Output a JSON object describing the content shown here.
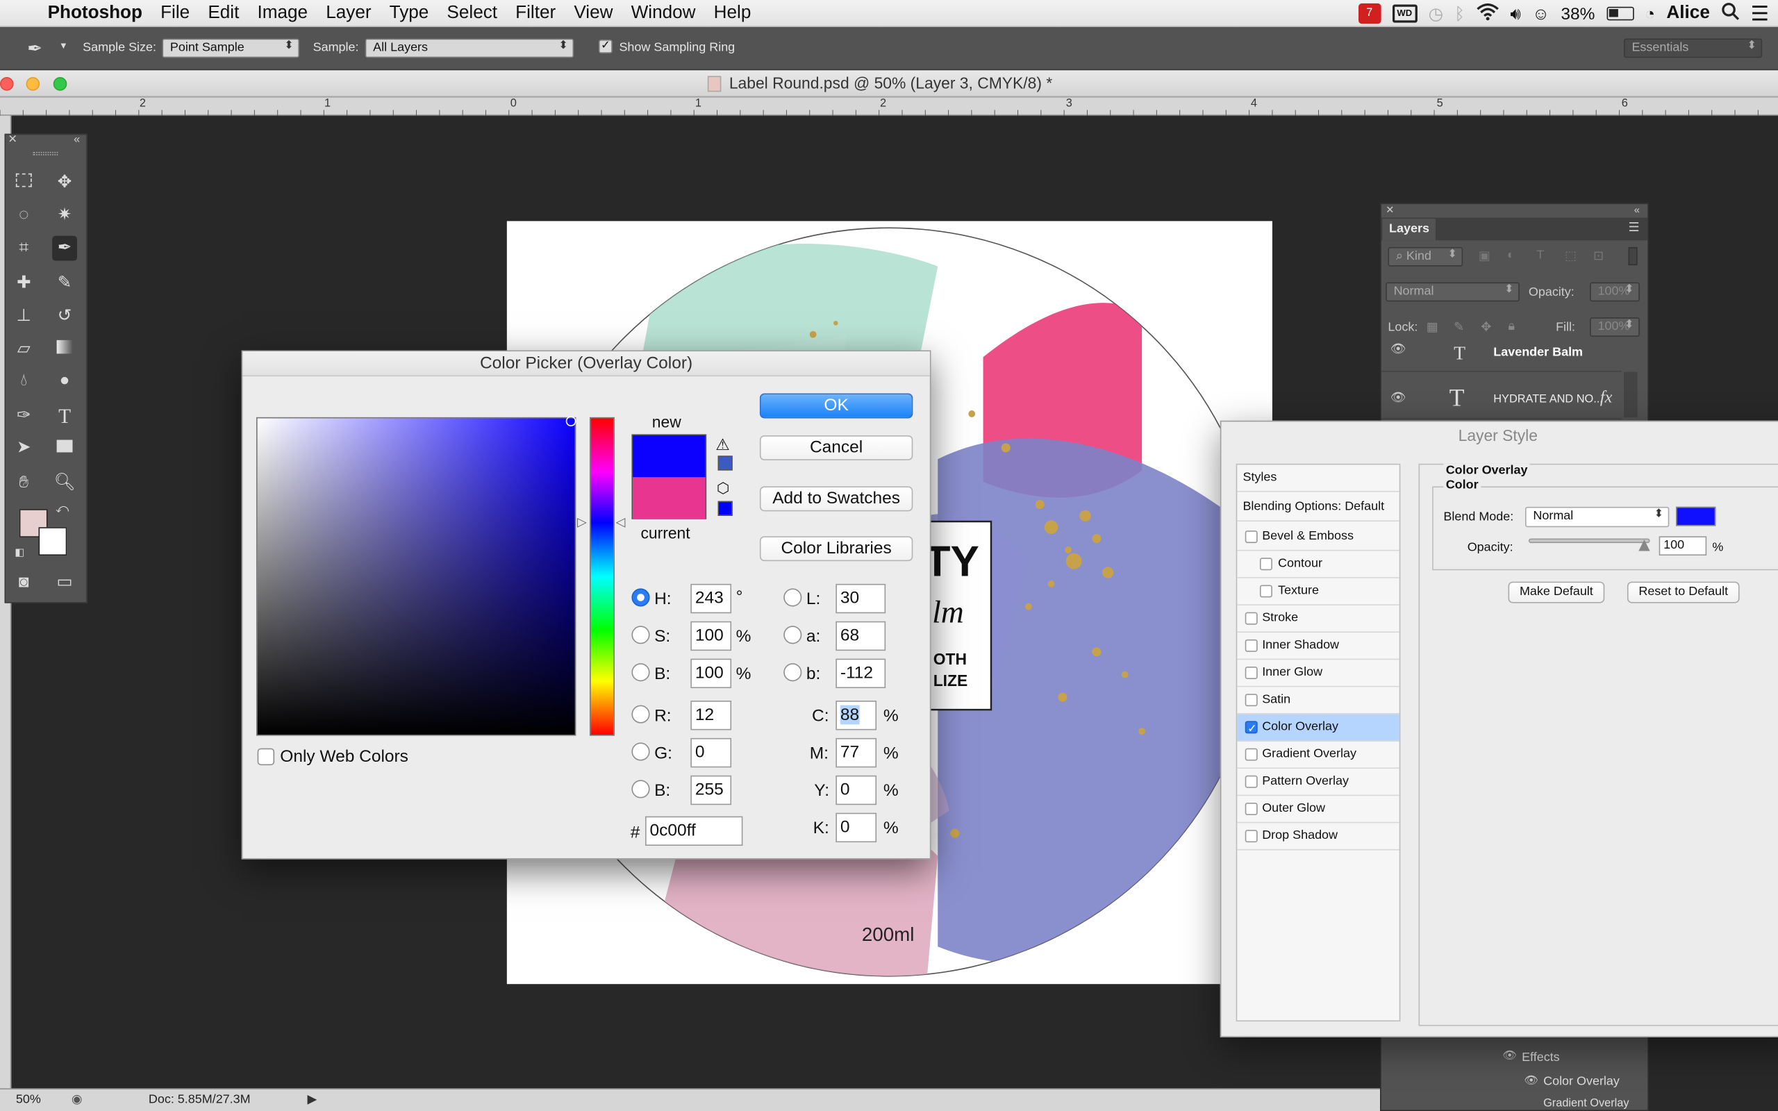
{
  "menubar": {
    "apple": "",
    "app": "Photoshop",
    "items": [
      "File",
      "Edit",
      "Image",
      "Layer",
      "Type",
      "Select",
      "Filter",
      "View",
      "Window",
      "Help"
    ],
    "battery": "38%",
    "user": "Alice"
  },
  "options": {
    "sample_size_label": "Sample Size:",
    "sample_size_value": "Point Sample",
    "sample_label": "Sample:",
    "sample_value": "All Layers",
    "show_ring_label": "Show Sampling Ring",
    "workspace": "Essentials"
  },
  "document": {
    "title": "Label Round.psd @ 50% (Layer 3, CMYK/8) *"
  },
  "ruler": {
    "ticks": [
      "2",
      "1",
      "0",
      "1",
      "2",
      "3",
      "4",
      "5",
      "6"
    ]
  },
  "canvas": {
    "label_text_1": "TY",
    "label_text_2": "lm",
    "label_text_3": "OTH",
    "label_text_4": "LIZE",
    "volume": "200ml"
  },
  "layers": {
    "tab": "Layers",
    "kind": "Kind",
    "blend": "Normal",
    "opacity_label": "Opacity:",
    "opacity_value": "100%",
    "lock_label": "Lock:",
    "fill_label": "Fill:",
    "fill_value": "100%",
    "items": [
      "Lavender Balm",
      "HYDRATE AND NO..."
    ],
    "fx": "fx",
    "effects_label": "Effects",
    "effect_items": [
      "Color Overlay",
      "Gradient Overlay"
    ]
  },
  "color_picker": {
    "title": "Color Picker (Overlay Color)",
    "new_label": "new",
    "current_label": "current",
    "new_color": "#0c00ff",
    "current_color": "#e8358f",
    "buttons": {
      "ok": "OK",
      "cancel": "Cancel",
      "add_swatches": "Add to Swatches",
      "libraries": "Color Libraries"
    },
    "only_web_label": "Only Web Colors",
    "hsb": {
      "h_label": "H:",
      "h": "243",
      "h_unit": "°",
      "s_label": "S:",
      "s": "100",
      "s_unit": "%",
      "b_label": "B:",
      "b": "100",
      "b_unit": "%"
    },
    "rgb": {
      "r_label": "R:",
      "r": "12",
      "g_label": "G:",
      "g": "0",
      "b_label": "B:",
      "b": "255"
    },
    "lab": {
      "l_label": "L:",
      "l": "30",
      "a_label": "a:",
      "a": "68",
      "b_label": "b:",
      "b": "-112"
    },
    "cmyk": {
      "c_label": "C:",
      "c": "88",
      "m_label": "M:",
      "m": "77",
      "y_label": "Y:",
      "y": "0",
      "k_label": "K:",
      "k": "0",
      "unit": "%"
    },
    "hex_label": "#",
    "hex": "0c00ff"
  },
  "layer_style": {
    "title": "Layer Style",
    "styles_header": "Styles",
    "blending": "Blending Options: Default",
    "items": [
      {
        "label": "Bevel & Emboss",
        "checked": false,
        "indent": false
      },
      {
        "label": "Contour",
        "checked": false,
        "indent": true
      },
      {
        "label": "Texture",
        "checked": false,
        "indent": true
      },
      {
        "label": "Stroke",
        "checked": false,
        "indent": false
      },
      {
        "label": "Inner Shadow",
        "checked": false,
        "indent": false
      },
      {
        "label": "Inner Glow",
        "checked": false,
        "indent": false
      },
      {
        "label": "Satin",
        "checked": false,
        "indent": false
      },
      {
        "label": "Color Overlay",
        "checked": true,
        "indent": false
      },
      {
        "label": "Gradient Overlay",
        "checked": false,
        "indent": false
      },
      {
        "label": "Pattern Overlay",
        "checked": false,
        "indent": false
      },
      {
        "label": "Outer Glow",
        "checked": false,
        "indent": false
      },
      {
        "label": "Drop Shadow",
        "checked": false,
        "indent": false
      }
    ],
    "section_title": "Color Overlay",
    "group_title": "Color",
    "blend_mode_label": "Blend Mode:",
    "blend_mode_value": "Normal",
    "overlay_color": "#1010ff",
    "opacity_label": "Opacity:",
    "opacity_value": "100",
    "opacity_unit": "%",
    "make_default": "Make Default",
    "reset_default": "Reset to Default"
  },
  "status": {
    "zoom": "50%",
    "doc": "Doc: 5.85M/27.3M"
  }
}
